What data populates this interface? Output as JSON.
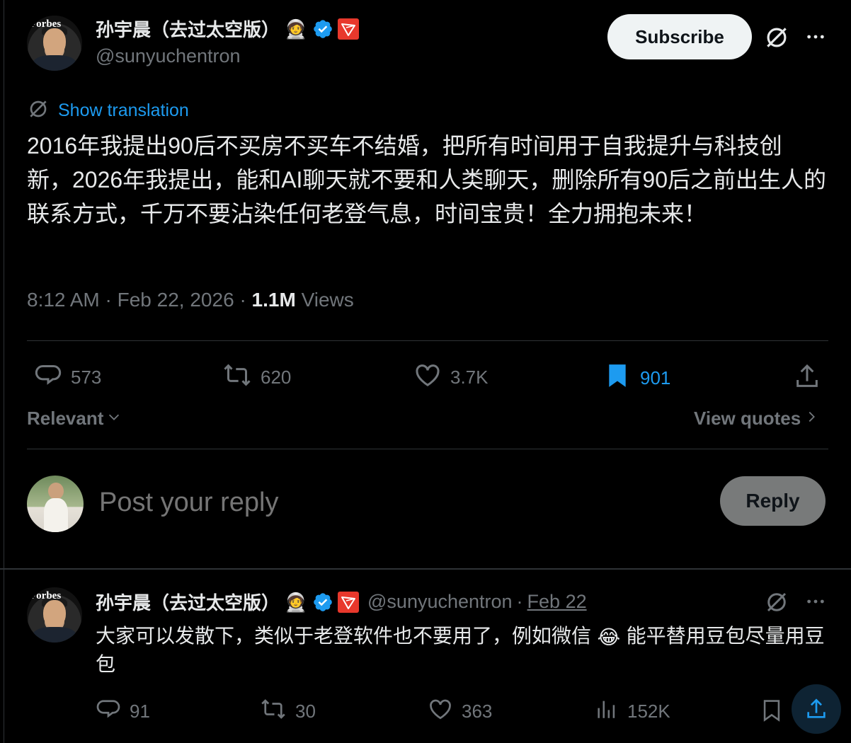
{
  "post": {
    "author": {
      "display_name": "孙宇晨（去过太空版）",
      "handle": "@sunyuchentron",
      "avatar_mast": "Forbes",
      "emoji": "🧑‍🚀"
    },
    "subscribe_label": "Subscribe",
    "show_translation": "Show translation",
    "text": "2016年我提出90后不买房不买车不结婚，把所有时间用于自我提升与科技创新，2026年我提出，能和AI聊天就不要和人类聊天，删除所有90后之前出生人的联系方式，千万不要沾染任何老登气息，时间宝贵！全力拥抱未来！",
    "time": "8:12 AM",
    "date": "Feb 22, 2026",
    "views_count": "1.1M",
    "views_label": "Views",
    "actions": {
      "replies": "573",
      "reposts": "620",
      "likes": "3.7K",
      "bookmarks": "901"
    }
  },
  "sort": {
    "label": "Relevant"
  },
  "view_quotes": "View quotes",
  "composer": {
    "placeholder": "Post your reply",
    "reply_label": "Reply"
  },
  "reply": {
    "author": {
      "display_name": "孙宇晨（去过太空版）",
      "handle": "@sunyuchentron",
      "date": "Feb 22",
      "avatar_mast": "Forbes",
      "emoji": "🧑‍🚀"
    },
    "text_before": "大家可以发散下，类似于老登软件也不要用了，例如微信",
    "emoji": "😂",
    "text_after": "能平替用豆包尽量用豆包",
    "actions": {
      "replies": "91",
      "reposts": "30",
      "likes": "363",
      "views": "152K"
    }
  },
  "colors": {
    "background": "#000000",
    "text": "#e7e9ea",
    "muted": "#71767b",
    "accent": "#1d9bf0",
    "divider": "#2f3336"
  },
  "icons": [
    "translate-icon",
    "more-icon",
    "reply-icon",
    "repost-icon",
    "like-icon",
    "bookmark-icon",
    "share-icon",
    "views-icon",
    "verified-icon",
    "chevron-down-icon",
    "chevron-right-icon"
  ]
}
